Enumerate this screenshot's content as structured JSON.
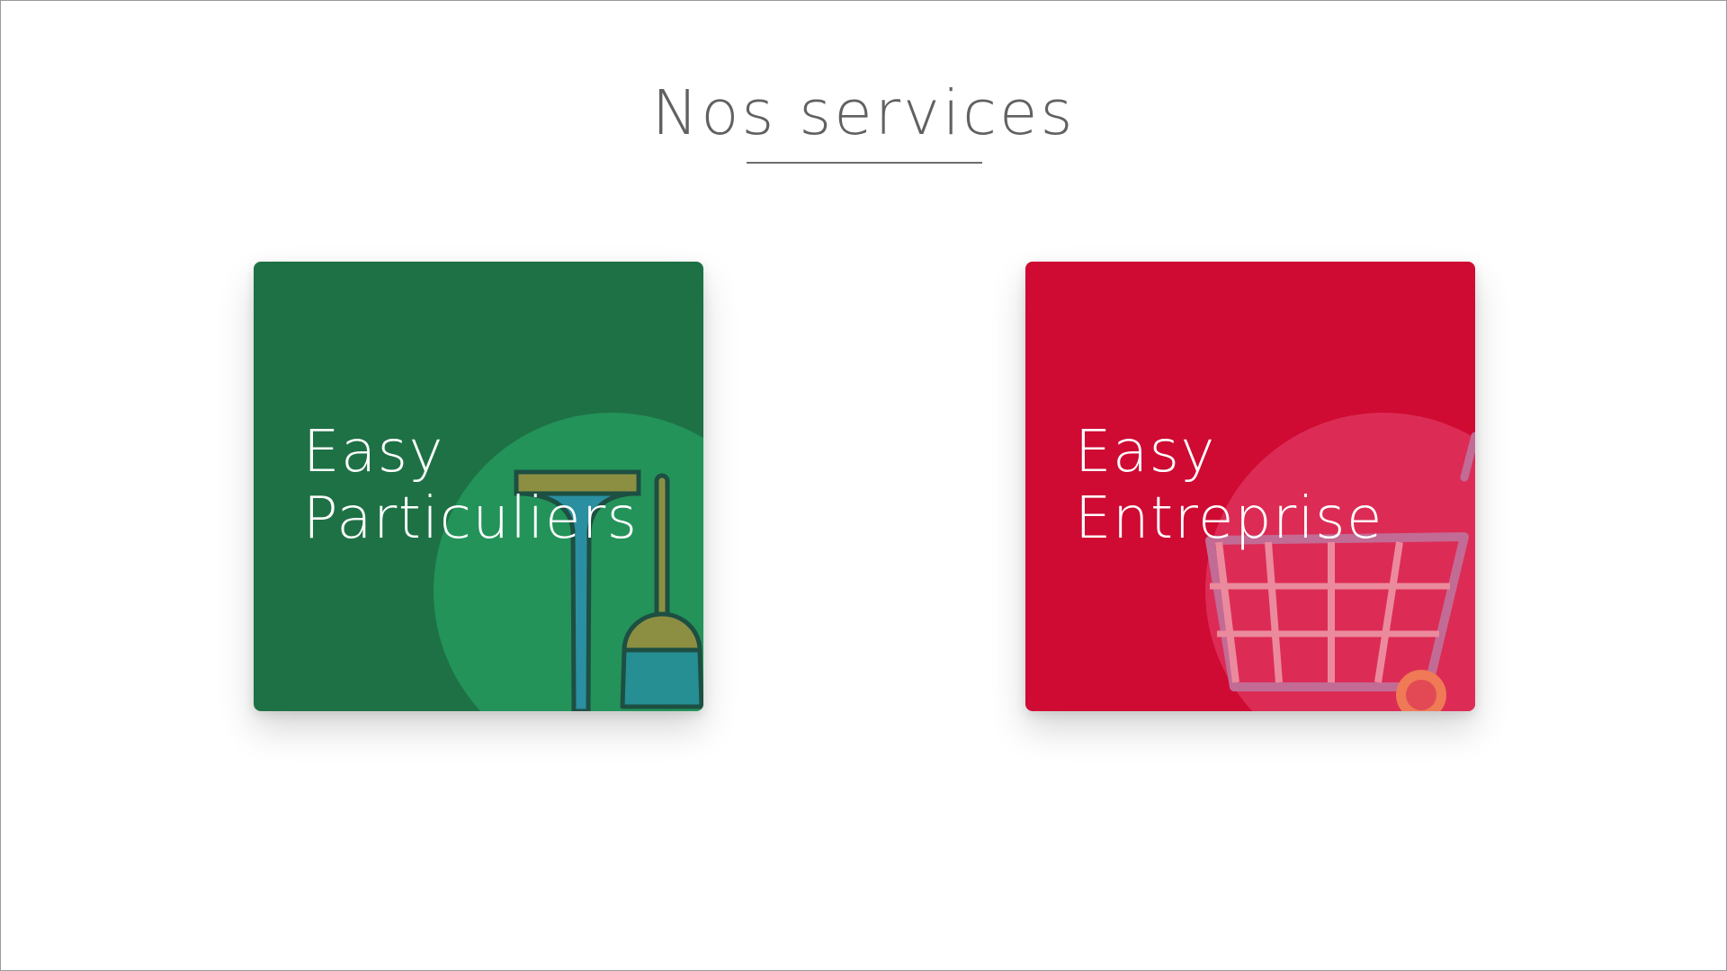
{
  "page": {
    "title": "Nos services"
  },
  "cards": [
    {
      "id": "particuliers",
      "line1": "Easy",
      "line2": "Particuliers",
      "background": "#1e7145",
      "accent": "#23935a",
      "icon": "broom-and-squeegee-icon"
    },
    {
      "id": "entreprise",
      "line1": "Easy",
      "line2": "Entreprise",
      "background": "#cf0a33",
      "accent": "#dc2c55",
      "icon": "shopping-cart-icon"
    }
  ]
}
